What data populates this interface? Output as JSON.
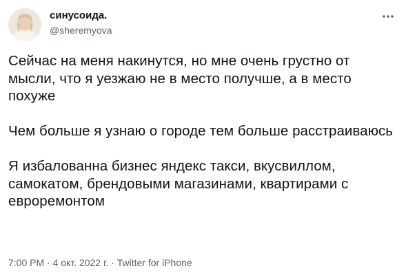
{
  "tweet": {
    "author": {
      "display_name": "синусоида.",
      "handle": "@sheremyova"
    },
    "more_icon": "more-dots-icon",
    "body": [
      "Сейчас на меня накинутся, но мне очень грустно от мысли, что я уезжаю не в место получше, а в место похуже",
      "Чем больше я узнаю о городе тем больше расстраиваюсь",
      "Я избалованна бизнес яндекс такси, вкусвиллом, самокатом, брендовыми магазинами, квартирами с евроремонтом"
    ],
    "meta": {
      "time": "7:00 PM",
      "separator": " · ",
      "date": "4 окт. 2022 г.",
      "source": "Twitter for iPhone"
    }
  },
  "colors": {
    "text": "#0f1419",
    "secondary": "#536471",
    "background": "#ffffff"
  }
}
